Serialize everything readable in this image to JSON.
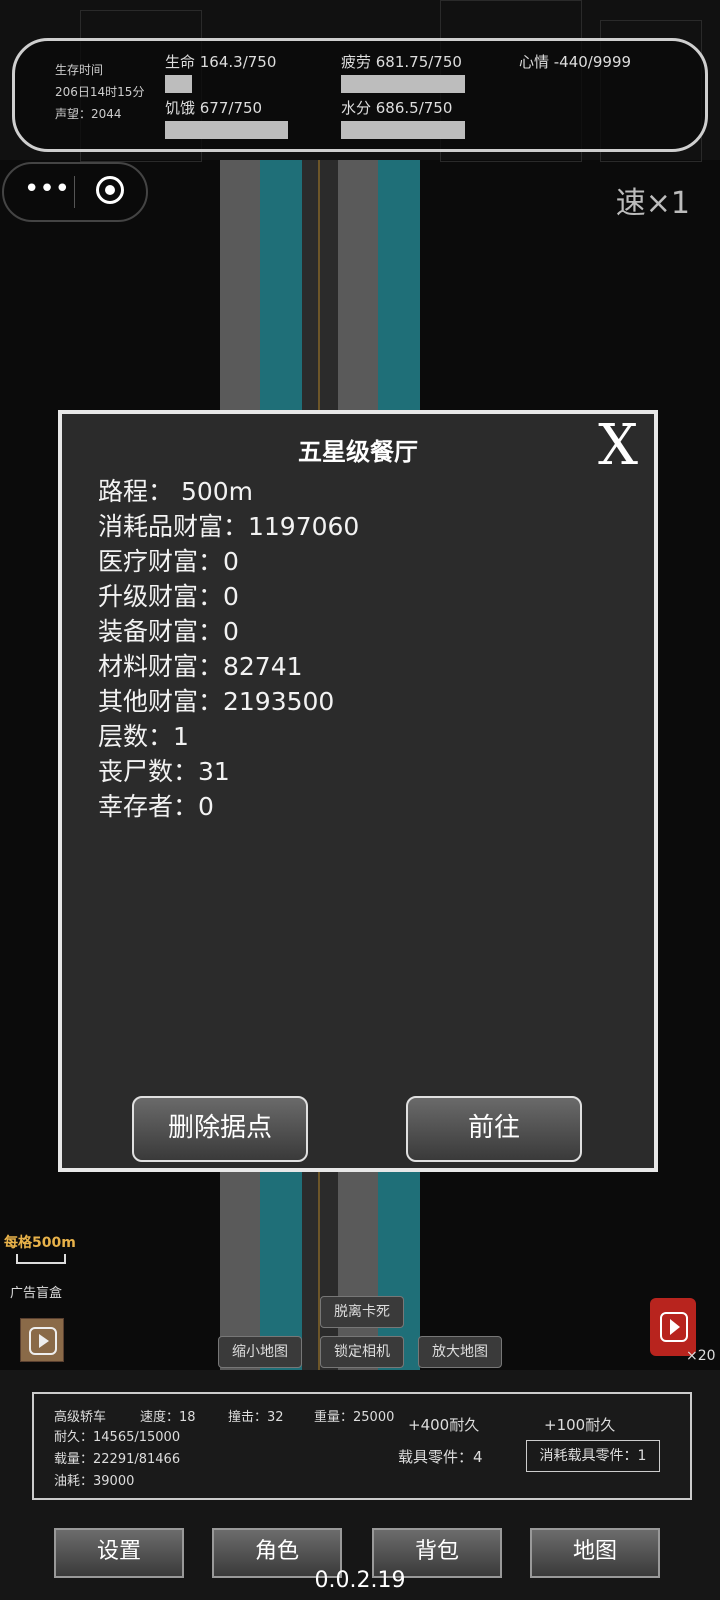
{
  "status": {
    "survival_label": "生存时间",
    "survival_time": "206日14时15分",
    "reputation": "声望：2044",
    "life": "生命 164.3/750",
    "life_fraction": 0.219,
    "fatigue": "疲劳 681.75/750",
    "fatigue_fraction": 0.909,
    "mood": "心情 -440/9999",
    "hunger": "饥饿 677/750",
    "hunger_fraction": 0.903,
    "water": "水分 686.5/750",
    "water_fraction": 0.915
  },
  "speed": "速×1",
  "modal": {
    "title": "五星级餐厅",
    "rows": [
      "路程：   500m",
      "消耗品财富：1197060",
      "医疗财富：0",
      "升级财富：0",
      "装备财富：0",
      "材料财富：82741",
      "其他财富：2193500",
      "层数：1",
      "丧尸数：31",
      "幸存者：0"
    ],
    "delete_label": "删除据点",
    "go_label": "前往",
    "close_label": "X"
  },
  "map": {
    "per_grid": "每格500m",
    "ad_box": "广告盲盒",
    "fuel_count": "×20",
    "unstuck": "脱离卡死",
    "zoom_out": "缩小地图",
    "lock_camera": "锁定相机",
    "zoom_in": "放大地图"
  },
  "vehicle": {
    "name": "高级轿车",
    "speed": "速度：18",
    "impact": "撞击：32",
    "weight": "重量：25000",
    "durability": "耐久：14565/15000",
    "load": "载量：22291/81466",
    "fuel": "油耗：39000",
    "add400": "+400耐久",
    "add100": "+100耐久",
    "parts": "载具零件：4",
    "consume_parts": "消耗载具零件：1"
  },
  "nav": {
    "settings": "设置",
    "character": "角色",
    "backpack": "背包",
    "map": "地图"
  },
  "version": "0.0.2.19"
}
